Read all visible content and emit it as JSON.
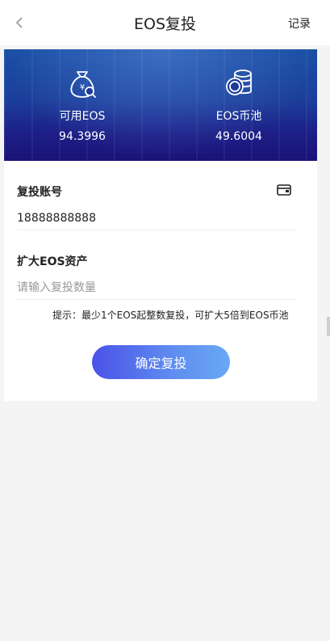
{
  "navbar": {
    "title": "EOS复投",
    "record_label": "记录",
    "back_icon": "chevron-left-icon"
  },
  "banner": {
    "available": {
      "label": "可用EOS",
      "value": "94.3996",
      "icon": "money-bag-icon"
    },
    "pool": {
      "label": "EOS币池",
      "value": "49.6004",
      "icon": "coin-stack-icon"
    }
  },
  "form": {
    "account": {
      "label": "复投账号",
      "value": "18888888888",
      "icon": "wallet-icon"
    },
    "quantity": {
      "label": "扩大EOS资产",
      "placeholder": "请输入复投数量"
    },
    "hint": "提示：最少1个EOS起整数复投，可扩大5倍到EOS币池",
    "submit_label": "确定复投"
  },
  "colors": {
    "banner_top": "#1a4fa4",
    "banner_bottom": "#1a1277",
    "button_start": "#4a52e8",
    "button_end": "#6aa8f4"
  }
}
